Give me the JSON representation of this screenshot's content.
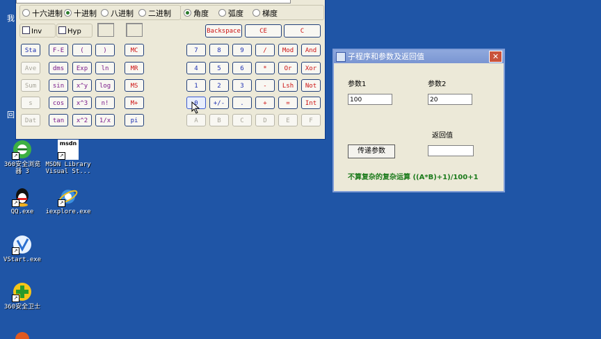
{
  "desktop": {
    "left_partial_chars": [
      "我",
      "回"
    ],
    "icons": [
      {
        "name": "360-browser-icon",
        "label_line1": "360安全浏览",
        "label_line2": "器 3"
      },
      {
        "name": "msdn-library-icon",
        "label_line1": "MSDN Library",
        "label_line2": "Visual St...",
        "brand": "msdn"
      },
      {
        "name": "qq-icon",
        "label_line1": "QQ.exe",
        "label_line2": ""
      },
      {
        "name": "iexplore-icon",
        "label_line1": "iexplore.exe",
        "label_line2": ""
      },
      {
        "name": "vstart-icon",
        "label_line1": "VStart.exe",
        "label_line2": ""
      },
      {
        "name": "360-security-icon",
        "label_line1": "360安全卫士",
        "label_line2": ""
      }
    ],
    "shortcut_arrow": "↗"
  },
  "calculator": {
    "base_radios": [
      {
        "label": "十六进制",
        "selected": false
      },
      {
        "label": "十进制",
        "selected": true
      },
      {
        "label": "八进制",
        "selected": false
      },
      {
        "label": "二进制",
        "selected": false
      }
    ],
    "angle_radios": [
      {
        "label": "角度",
        "selected": true
      },
      {
        "label": "弧度",
        "selected": false
      },
      {
        "label": "梯度",
        "selected": false
      }
    ],
    "checkboxes": {
      "inv": "Inv",
      "hyp": "Hyp"
    },
    "top_buttons": {
      "backspace": "Backspace",
      "ce": "CE",
      "c": "C"
    },
    "stat_buttons": [
      "Sta",
      "Ave",
      "Sum",
      "s",
      "Dat"
    ],
    "fn_col1": [
      "F-E",
      "dms",
      "sin",
      "cos",
      "tan"
    ],
    "fn_col2": [
      "(",
      "Exp",
      "x^y",
      "x^3",
      "x^2"
    ],
    "fn_col3": [
      ")",
      "ln",
      "log",
      "n!",
      "1/x"
    ],
    "mem_buttons": [
      "MC",
      "MR",
      "MS",
      "M+",
      "pi"
    ],
    "keypad_rows": [
      [
        "7",
        "8",
        "9",
        "/",
        "Mod",
        "And"
      ],
      [
        "4",
        "5",
        "6",
        "*",
        "Or",
        "Xor"
      ],
      [
        "1",
        "2",
        "3",
        "-",
        "Lsh",
        "Not"
      ],
      [
        "0",
        "+/-",
        ".",
        "+",
        "=",
        "Int"
      ],
      [
        "A",
        "B",
        "C",
        "D",
        "E",
        "F"
      ]
    ]
  },
  "dialog": {
    "title": "子程序和参数及返回值",
    "close": "✕",
    "param1_label": "参数1",
    "param1_value": "100",
    "param2_label": "参数2",
    "param2_value": "20",
    "return_label": "返回值",
    "return_value": "",
    "pass_button": "传递参数",
    "formula": "不算复杂的复杂运算 ((A*B)+1)/100+1"
  },
  "colors": {
    "desktop": "#1f55a6",
    "window_face": "#ece9d8",
    "formula_green": "#1a7a1a"
  }
}
